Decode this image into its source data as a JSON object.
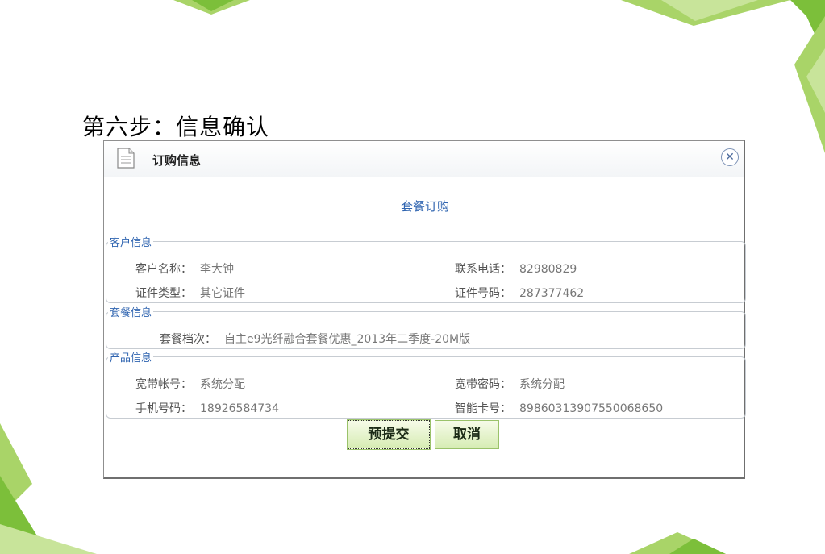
{
  "page_title": "第六步：信息确认",
  "dialog": {
    "title": "订购信息",
    "close_icon": "close-icon",
    "heading": "套餐订购"
  },
  "customer_info": {
    "legend": "客户信息",
    "name_label": "客户名称：",
    "name_value": "李大钟",
    "phone_label": "联系电话：",
    "phone_value": "82980829",
    "id_type_label": "证件类型：",
    "id_type_value": "其它证件",
    "id_number_label": "证件号码：",
    "id_number_value": "287377462"
  },
  "package_info": {
    "legend": "套餐信息",
    "tier_label": "套餐档次：",
    "tier_value": "自主e9光纤融合套餐优惠_2013年二季度-20M版"
  },
  "product_info": {
    "legend": "产品信息",
    "bb_account_label": "宽带帐号：",
    "bb_account_value": "系统分配",
    "bb_password_label": "宽带密码：",
    "bb_password_value": "系统分配",
    "mobile_label": "手机号码：",
    "mobile_value": "18926584734",
    "smartcard_label": "智能卡号：",
    "smartcard_value": "89860313907550068650"
  },
  "buttons": {
    "submit_label": "预提交",
    "cancel_label": "取消"
  },
  "colors": {
    "accent_blue": "#2f64b0",
    "button_green": "#d6ecb3",
    "decor_green": "#8cc63f"
  }
}
